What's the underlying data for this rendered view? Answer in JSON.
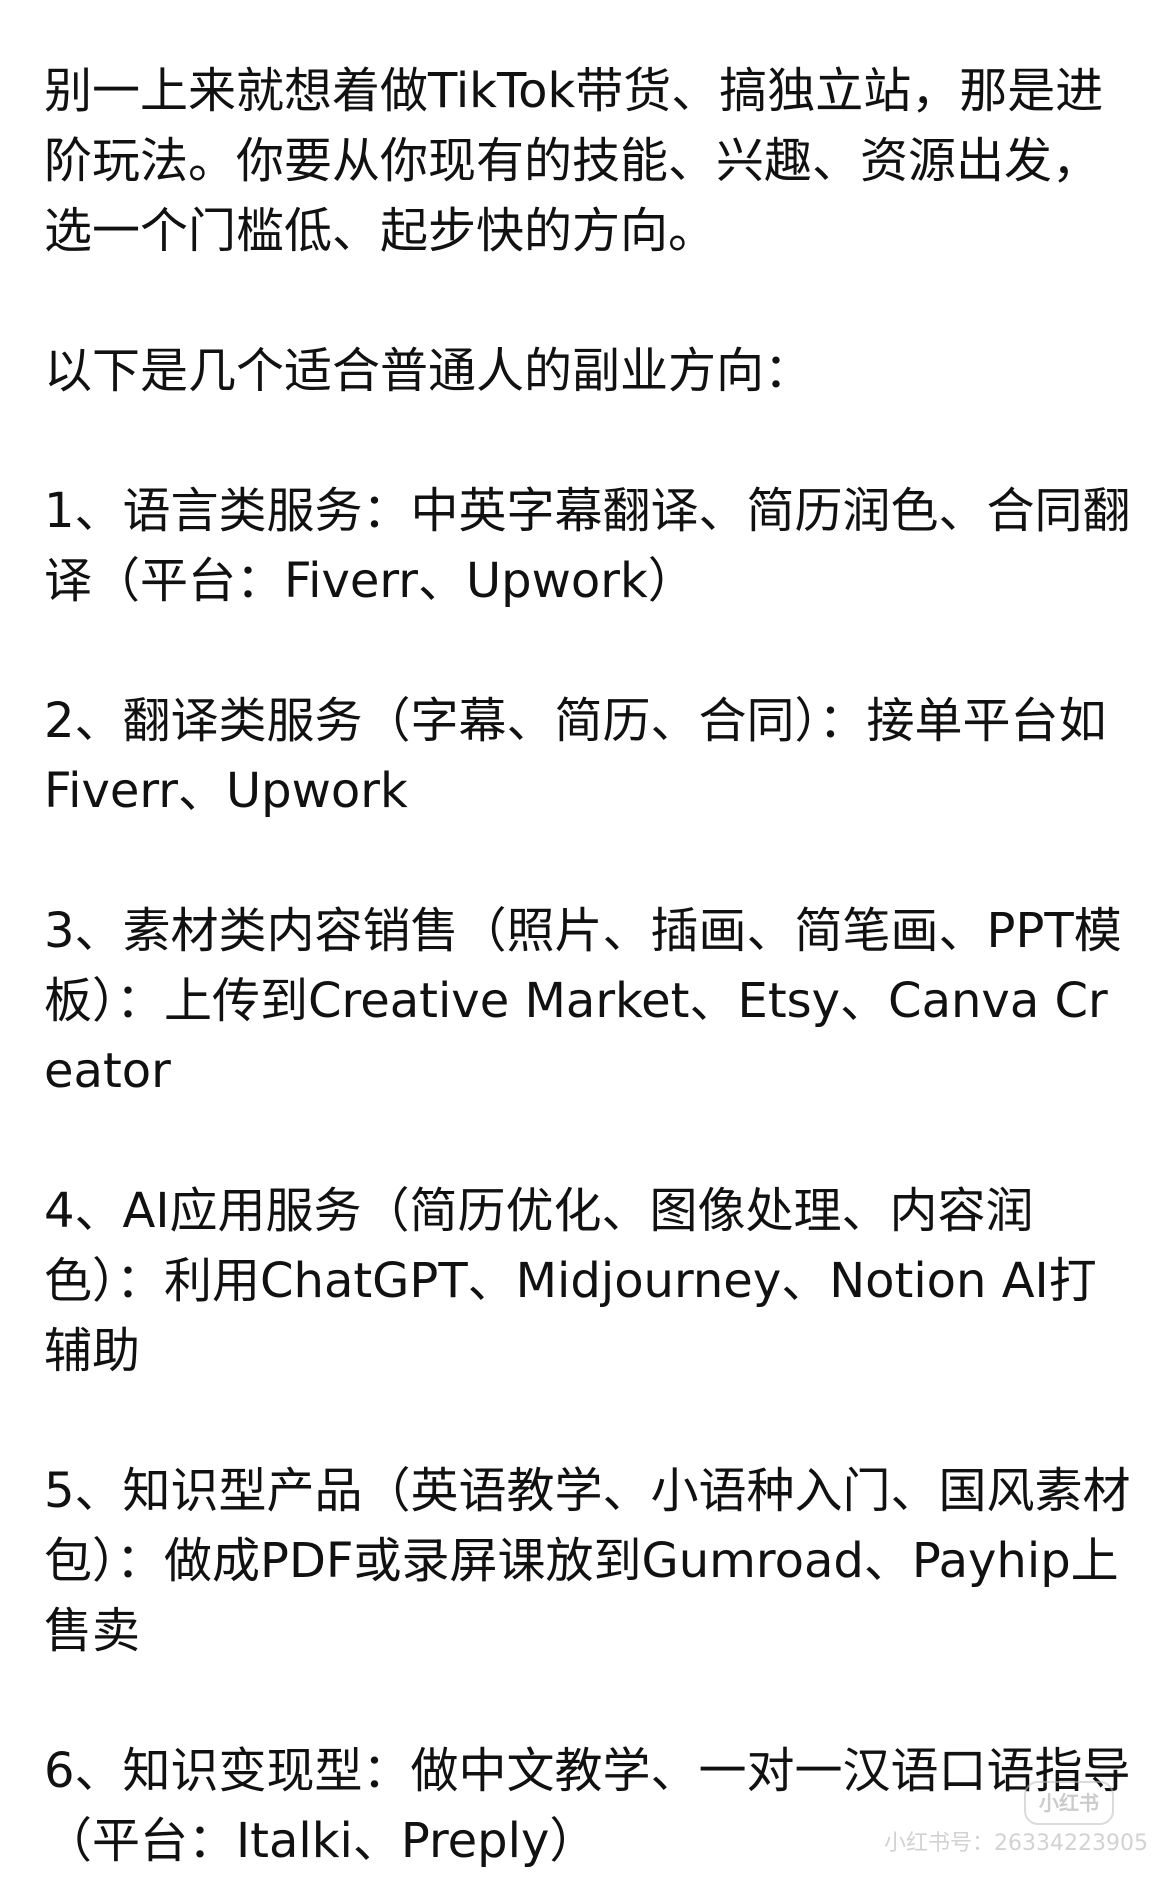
{
  "paragraphs": [
    "别一上来就想着做TikTok带货、搞独立站，那是进阶玩法。你要从你现有的技能、兴趣、资源出发，选一个门槛低、起步快的方向。",
    "以下是几个适合普通人的副业方向：",
    "1、语言类服务：中英字幕翻译、简历润色、合同翻译（平台：Fiverr、Upwork）",
    "2、翻译类服务（字幕、简历、合同）：接单平台如Fiverr、Upwork",
    "3、素材类内容销售（照片、插画、简笔画、PPT模板）：上传到Creative Market、Etsy、Canva Creator",
    "4、AI应用服务（简历优化、图像处理、内容润色）：利用ChatGPT、Midjourney、Notion AI打辅助",
    "5、知识型产品（英语教学、小语种入门、国风素材包）：做成PDF或录屏课放到Gumroad、Payhip上售卖",
    "6、知识变现型：做中文教学、一对一汉语口语指导（平台：Italki、Preply）"
  ],
  "watermark": {
    "logo": "小红书",
    "id_text": "小红书号：26334223905"
  }
}
